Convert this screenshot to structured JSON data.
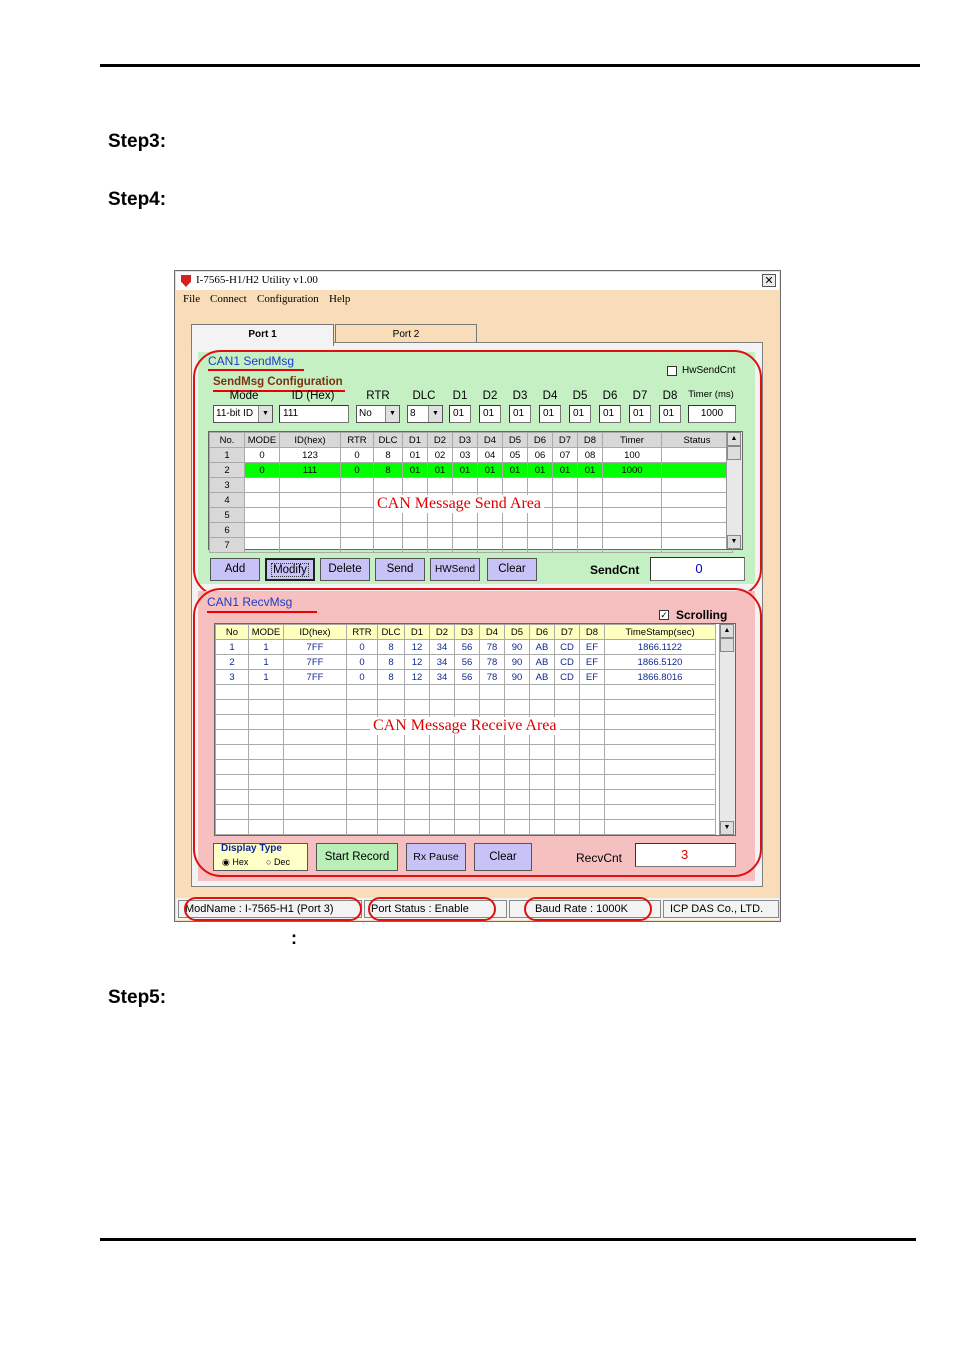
{
  "page": {
    "steps": [
      "Step3:",
      "Step4:",
      "Step5:"
    ],
    "caption_colon": ":"
  },
  "window": {
    "title": "I-7565-H1/H2 Utility v1.00",
    "close": "✕",
    "menu": [
      "File",
      "Connect",
      "Configuration",
      "Help"
    ],
    "tabs": [
      "Port 1",
      "Port 2"
    ],
    "send": {
      "caption": "CAN1 SendMsg",
      "hwsendcnt_label": "HwSendCnt",
      "config_caption": "SendMsg Configuration",
      "labels": [
        "Mode",
        "ID (Hex)",
        "RTR",
        "DLC",
        "D1",
        "D2",
        "D3",
        "D4",
        "D5",
        "D6",
        "D7",
        "D8",
        "Timer (ms)"
      ],
      "mode": "11-bit ID",
      "id": "111",
      "rtr": "No",
      "dlc": "8",
      "data": [
        "01",
        "01",
        "01",
        "01",
        "01",
        "01",
        "01",
        "01"
      ],
      "timer": "1000",
      "columns": [
        "No.",
        "MODE",
        "ID(hex)",
        "RTR",
        "DLC",
        "D1",
        "D2",
        "D3",
        "D4",
        "D5",
        "D6",
        "D7",
        "D8",
        "Timer",
        "Status"
      ],
      "rows": [
        [
          "1",
          "0",
          "123",
          "0",
          "8",
          "01",
          "02",
          "03",
          "04",
          "05",
          "06",
          "07",
          "08",
          "100",
          ""
        ],
        [
          "2",
          "0",
          "111",
          "0",
          "8",
          "01",
          "01",
          "01",
          "01",
          "01",
          "01",
          "01",
          "01",
          "1000",
          ""
        ],
        [
          "3",
          "",
          "",
          "",
          "",
          "",
          "",
          "",
          "",
          "",
          "",
          "",
          "",
          "",
          ""
        ],
        [
          "4",
          "",
          "",
          "",
          "",
          "",
          "",
          "",
          "",
          "",
          "",
          "",
          "",
          "",
          ""
        ],
        [
          "5",
          "",
          "",
          "",
          "",
          "",
          "",
          "",
          "",
          "",
          "",
          "",
          "",
          "",
          ""
        ],
        [
          "6",
          "",
          "",
          "",
          "",
          "",
          "",
          "",
          "",
          "",
          "",
          "",
          "",
          "",
          ""
        ],
        [
          "7",
          "",
          "",
          "",
          "",
          "",
          "",
          "",
          "",
          "",
          "",
          "",
          "",
          "",
          ""
        ]
      ],
      "overlay": "CAN Message Send Area",
      "buttons": [
        "Add",
        "Modify",
        "Delete",
        "Send",
        "HWSend",
        "Clear"
      ],
      "cnt_label": "SendCnt",
      "cnt_value": "0"
    },
    "recv": {
      "caption": "CAN1 RecvMsg",
      "scrolling_label": "Scrolling",
      "columns": [
        "No",
        "MODE",
        "ID(hex)",
        "RTR",
        "DLC",
        "D1",
        "D2",
        "D3",
        "D4",
        "D5",
        "D6",
        "D7",
        "D8",
        "TimeStamp(sec)"
      ],
      "rows": [
        [
          "1",
          "1",
          "7FF",
          "0",
          "8",
          "12",
          "34",
          "56",
          "78",
          "90",
          "AB",
          "CD",
          "EF",
          "1866.1122"
        ],
        [
          "2",
          "1",
          "7FF",
          "0",
          "8",
          "12",
          "34",
          "56",
          "78",
          "90",
          "AB",
          "CD",
          "EF",
          "1866.5120"
        ],
        [
          "3",
          "1",
          "7FF",
          "0",
          "8",
          "12",
          "34",
          "56",
          "78",
          "90",
          "AB",
          "CD",
          "EF",
          "1866.8016"
        ]
      ],
      "overlay": "CAN Message Receive Area",
      "display_type": "Display Type",
      "hex": "Hex",
      "dec": "Dec",
      "buttons": [
        "Start Record",
        "Rx Pause",
        "Clear"
      ],
      "cnt_label": "RecvCnt",
      "cnt_value": "3"
    },
    "status": [
      "ModName : I-7565-H1 (Port 3)",
      "Port Status : Enable",
      "Baud Rate : 1000K",
      "ICP DAS Co., LTD."
    ]
  },
  "colors": {
    "window_bg": "#f9dcb8",
    "send_bg": "#c4f0c4",
    "recv_bg": "#f6c0c0",
    "highlight_row": "#00ff00",
    "annotation": "#e00000",
    "send_button": "#c7c3f6"
  }
}
